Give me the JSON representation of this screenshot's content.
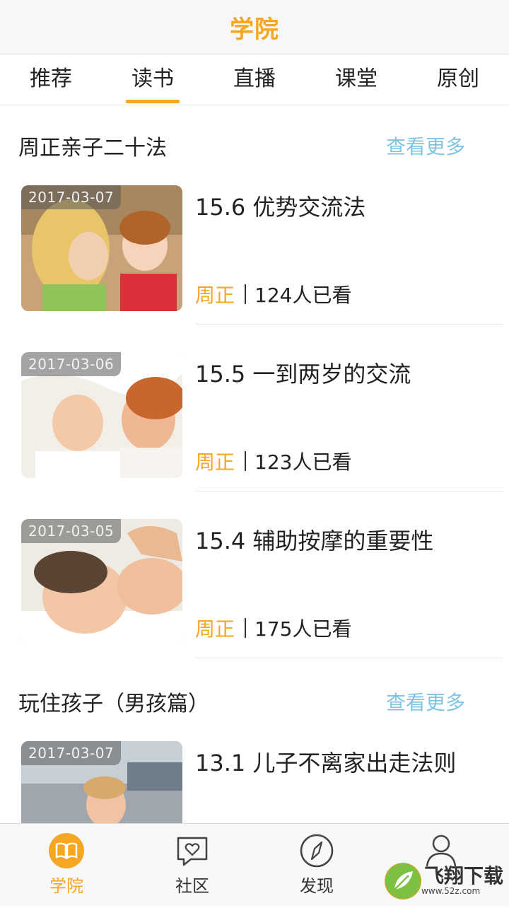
{
  "header": {
    "title": "学院"
  },
  "tabs": [
    {
      "label": "推荐"
    },
    {
      "label": "读书"
    },
    {
      "label": "直播"
    },
    {
      "label": "课堂"
    },
    {
      "label": "原创"
    }
  ],
  "sections": [
    {
      "title": "周正亲子二十法",
      "more": "查看更多",
      "items": [
        {
          "date": "2017-03-07",
          "title": "15.6 优势交流法",
          "author": "周正",
          "views": "124人已看"
        },
        {
          "date": "2017-03-06",
          "title": "15.5 一到两岁的交流",
          "author": "周正",
          "views": "123人已看"
        },
        {
          "date": "2017-03-05",
          "title": "15.4 辅助按摩的重要性",
          "author": "周正",
          "views": "175人已看"
        }
      ]
    },
    {
      "title": "玩住孩子（男孩篇）",
      "more": "查看更多",
      "items": [
        {
          "date": "2017-03-07",
          "title": "13.1 儿子不离家出走法则"
        }
      ]
    }
  ],
  "bottom_nav": [
    {
      "label": "学院",
      "icon": "book-icon"
    },
    {
      "label": "社区",
      "icon": "heart-chat-icon"
    },
    {
      "label": "发现",
      "icon": "compass-icon"
    },
    {
      "label": "",
      "icon": "user-icon"
    }
  ],
  "watermark": {
    "text": "飞翔下载",
    "sub": "www.52z.com"
  },
  "colors": {
    "accent": "#f5a623",
    "link": "#7fc4e3"
  }
}
